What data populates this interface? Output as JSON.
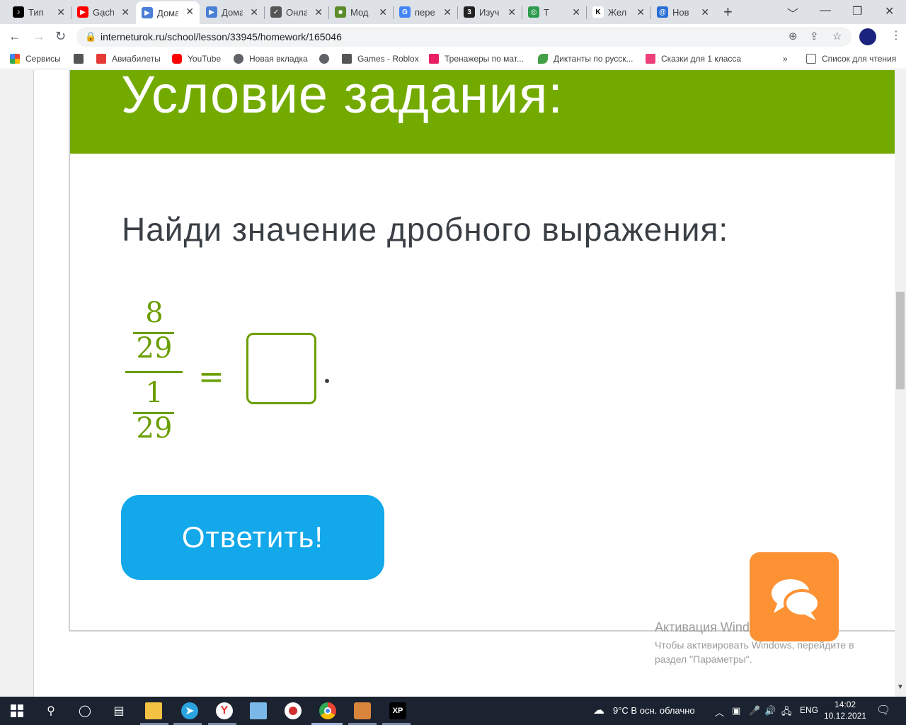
{
  "browser": {
    "tabs": [
      {
        "title": "Тип",
        "color": "#000000",
        "glyph": "♪"
      },
      {
        "title": "Gạch",
        "color": "#ff0000",
        "glyph": "▶"
      },
      {
        "title": "Дома",
        "color": "#4a7fd6",
        "glyph": "▶",
        "active": true
      },
      {
        "title": "Дома",
        "color": "#4a7fd6",
        "glyph": "▶"
      },
      {
        "title": "Онла",
        "color": "#555555",
        "glyph": "✓"
      },
      {
        "title": "Мод",
        "color": "#5b8c2a",
        "glyph": "■"
      },
      {
        "title": "пере",
        "color": "#4285f4",
        "glyph": "G"
      },
      {
        "title": "Изуч",
        "color": "#222222",
        "glyph": "3"
      },
      {
        "title": "Т",
        "color": "#2e9b4e",
        "glyph": "◎"
      },
      {
        "title": "Жел",
        "color": "#ffffff",
        "glyph": "K"
      },
      {
        "title": "Нов",
        "color": "#2a6fd6",
        "glyph": "@"
      }
    ],
    "new_tab": "+",
    "window_controls": [
      "﹀",
      "—",
      "❐",
      "✕"
    ],
    "url": "interneturok.ru/school/lesson/33945/homework/165046",
    "bookmarks": [
      {
        "label": "Сервисы",
        "color": "#ea4335"
      },
      {
        "label": "",
        "color": "#555555"
      },
      {
        "label": "Авиабилеты",
        "color": "#e53935"
      },
      {
        "label": "YouTube",
        "color": "#ff0000"
      },
      {
        "label": "Новая вкладка",
        "color": "#5f6368"
      },
      {
        "label": "",
        "color": "#5f6368"
      },
      {
        "label": "Games - Roblox",
        "color": "#555555"
      },
      {
        "label": "Тренажеры по мат...",
        "color": "#e91e63"
      },
      {
        "label": "Диктанты по русск...",
        "color": "#43a047"
      },
      {
        "label": "Сказки для 1 класса",
        "color": "#ec407a"
      }
    ],
    "bookmarks_more": "»",
    "reading_list": "Список для чтения"
  },
  "page": {
    "banner_title": "Условие задания:",
    "task_text": "Найди значение дробного выражения:",
    "fraction": {
      "top_numerator": "8",
      "top_denominator": "29",
      "bottom_numerator": "1",
      "bottom_denominator": "29"
    },
    "equals": "=",
    "answer_value": "",
    "answer_button": "Ответить!",
    "activation_title": "Активация Windows",
    "activation_text_line1": "Чтобы активировать Windows, перейдите в",
    "activation_text_line2": "раздел \"Параметры\"."
  },
  "taskbar": {
    "weather": "9°C  В осн. облачно",
    "language": "ENG",
    "time": "14:02",
    "date": "10.12.2021"
  }
}
